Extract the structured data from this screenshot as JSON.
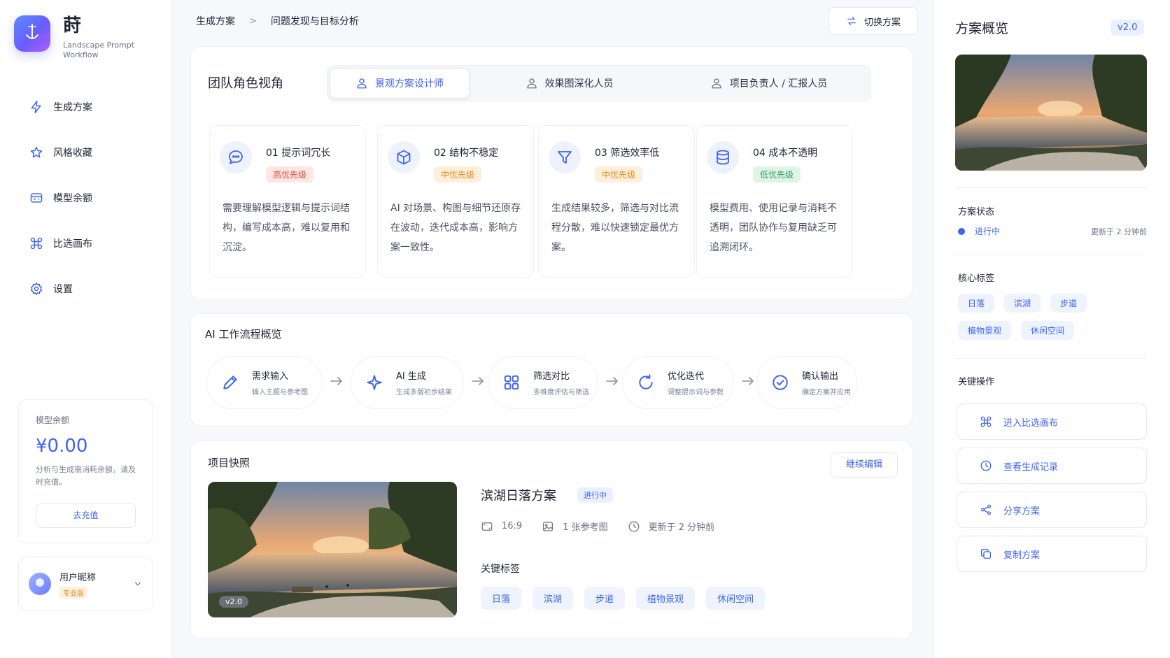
{
  "brand": {
    "name": "莳",
    "subtitle": "Landscape Prompt Workflow"
  },
  "nav": {
    "items": [
      {
        "label": "生成方案",
        "icon": "lightning-icon"
      },
      {
        "label": "风格收藏",
        "icon": "star-icon"
      },
      {
        "label": "模型余额",
        "icon": "wallet-icon"
      },
      {
        "label": "比选画布",
        "icon": "command-icon"
      },
      {
        "label": "设置",
        "icon": "gear-icon"
      }
    ]
  },
  "balance": {
    "title": "模型余额",
    "amount": "¥0.00",
    "note": "分析与生成需消耗余额，请及时充值。",
    "recharge_label": "去充值"
  },
  "user": {
    "name": "用户昵称",
    "badge": "专业版"
  },
  "breadcrumb": {
    "root": "生成方案",
    "sep": ">",
    "current": "问题发现与目标分析"
  },
  "switch_label": "切换方案",
  "roles": {
    "title": "团队角色视角",
    "tabs": [
      {
        "label": "景观方案设计师",
        "active": true
      },
      {
        "label": "效果图深化人员",
        "active": false
      },
      {
        "label": "项目负责人 / 汇报人员",
        "active": false
      }
    ]
  },
  "problems": [
    {
      "title": "01  提示词冗长",
      "priority": "高优先级",
      "level": "high",
      "desc": "需要理解模型逻辑与提示词结构，编写成本高，难以复用和沉淀。",
      "icon": "chat-bubble-icon"
    },
    {
      "title": "02  结构不稳定",
      "priority": "中优先级",
      "level": "mid",
      "desc": "AI 对场景、构图与细节还原存在波动，迭代成本高，影响方案一致性。",
      "icon": "cube-icon"
    },
    {
      "title": "03  筛选效率低",
      "priority": "中优先级",
      "level": "mid",
      "desc": "生成结果较多，筛选与对比流程分散，难以快速锁定最优方案。",
      "icon": "filter-icon"
    },
    {
      "title": "04  成本不透明",
      "priority": "低优先级",
      "level": "low",
      "desc": "模型费用、使用记录与消耗不透明，团队协作与复用缺乏可追溯闭环。",
      "icon": "database-icon"
    }
  ],
  "workflow": {
    "title": "AI 工作流程概览",
    "steps": [
      {
        "title": "需求输入",
        "sub": "输入主题与参考图",
        "icon": "pencil-icon"
      },
      {
        "title": "AI 生成",
        "sub": "生成多版初步结果",
        "icon": "sparkle-icon"
      },
      {
        "title": "筛选对比",
        "sub": "多维度评估与筛选",
        "icon": "grid-icon"
      },
      {
        "title": "优化迭代",
        "sub": "调整提示词与参数",
        "icon": "refresh-icon"
      },
      {
        "title": "确认输出",
        "sub": "确定方案并应用",
        "icon": "check-circle-icon"
      }
    ],
    "arrow": "→"
  },
  "snapshot": {
    "title": "项目快照",
    "edit_label": "继续编辑",
    "version": "v2.0",
    "name": "滨湖日落方案",
    "status": "进行中",
    "meta": {
      "ratio": "16:9",
      "refs": "1 张参考图",
      "updated": "更新于 2 分钟前"
    },
    "tags_title": "关键标签",
    "tags": [
      "日落",
      "滨湖",
      "步道",
      "植物景观",
      "休闲空间"
    ]
  },
  "overview": {
    "title": "方案概览",
    "version": "v2.0",
    "status_title": "方案状态",
    "status": "进行中",
    "updated": "更新于 2 分钟前",
    "tags_title": "核心标签",
    "tags": [
      "日落",
      "滨湖",
      "步道",
      "植物景观",
      "休闲空间"
    ],
    "actions_title": "关键操作",
    "actions": [
      {
        "label": "进入比选画布",
        "icon": "command-icon"
      },
      {
        "label": "查看生成记录",
        "icon": "clock-icon"
      },
      {
        "label": "分享方案",
        "icon": "share-icon"
      },
      {
        "label": "复制方案",
        "icon": "copy-icon"
      }
    ]
  },
  "colors": {
    "accent": "#3e64f0",
    "high": "#e2483d",
    "mid": "#e08a1e",
    "low": "#2e9e5e"
  }
}
